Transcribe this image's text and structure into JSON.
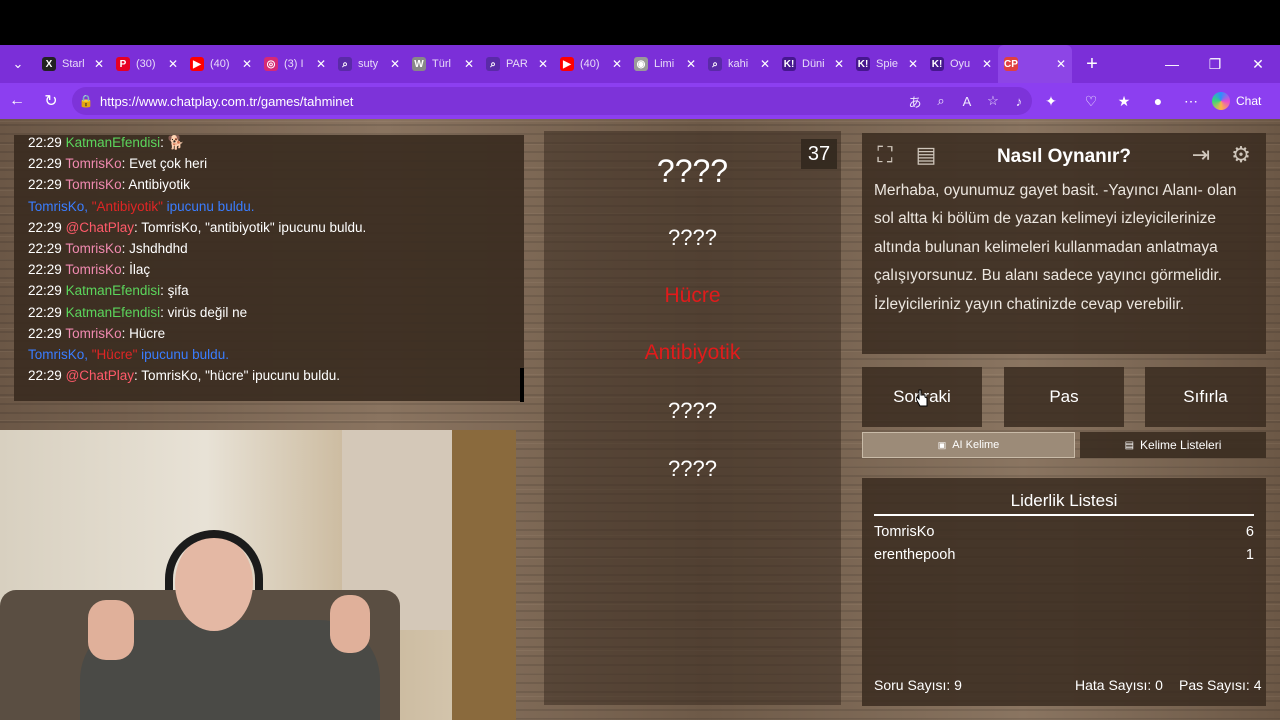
{
  "browser": {
    "tabs": [
      {
        "title": "Starl",
        "icon": "x-icon",
        "color": "#222222",
        "glyph": "X"
      },
      {
        "title": "(30)",
        "icon": "pinterest-icon",
        "color": "#e60023",
        "glyph": "P"
      },
      {
        "title": "(40)",
        "icon": "youtube-icon",
        "color": "#ff0000",
        "glyph": "▶"
      },
      {
        "title": "(3) I",
        "icon": "instagram-icon",
        "color": "#d62976",
        "glyph": "◎"
      },
      {
        "title": "suty",
        "icon": "search-icon",
        "color": "#5a2aa8",
        "glyph": "⌕"
      },
      {
        "title": "Türl",
        "icon": "wikipedia-icon",
        "color": "#888888",
        "glyph": "W"
      },
      {
        "title": "PAR",
        "icon": "search-icon",
        "color": "#5a2aa8",
        "glyph": "⌕"
      },
      {
        "title": "(40)",
        "icon": "youtube-icon",
        "color": "#ff0000",
        "glyph": "▶"
      },
      {
        "title": "Limi",
        "icon": "globe-icon",
        "color": "#9a9a9a",
        "glyph": "◉"
      },
      {
        "title": "kahi",
        "icon": "search-icon",
        "color": "#5a2aa8",
        "glyph": "⌕"
      },
      {
        "title": "Düni",
        "icon": "kahoot-icon",
        "color": "#46178f",
        "glyph": "K!"
      },
      {
        "title": "Spie",
        "icon": "kahoot-icon",
        "color": "#46178f",
        "glyph": "K!"
      },
      {
        "title": "Oyu",
        "icon": "kahoot-icon",
        "color": "#46178f",
        "glyph": "K!"
      },
      {
        "title": "",
        "icon": "chatplay-icon",
        "color": "#e04040",
        "glyph": "CP",
        "active": true
      }
    ],
    "url": "https://www.chatplay.com.tr/games/tahminet",
    "chat_label": "Chat"
  },
  "chat": {
    "messages": [
      {
        "time": "22:29",
        "user": "KatmanEfendisi",
        "user_color": "green",
        "text": ": 🐕"
      },
      {
        "time": "22:29",
        "user": "TomrisKo",
        "user_color": "pink",
        "text": ": Evet çok heri"
      },
      {
        "time": "22:29",
        "user": "TomrisKo",
        "user_color": "pink",
        "text": ": Antibiyotik"
      },
      {
        "system": true,
        "pre": "TomrisKo, ",
        "word": "\"Antibiyotik\"",
        "post": " ipucunu buldu."
      },
      {
        "time": "22:29",
        "user": "@ChatPlay",
        "user_color": "red",
        "text": ": TomrisKo, \"antibiyotik\" ipucunu buldu."
      },
      {
        "time": "22:29",
        "user": "TomrisKo",
        "user_color": "pink",
        "text": ": Jshdhdhd"
      },
      {
        "time": "22:29",
        "user": "TomrisKo",
        "user_color": "pink",
        "text": ": İlaç"
      },
      {
        "time": "22:29",
        "user": "KatmanEfendisi",
        "user_color": "green",
        "text": ": şifa"
      },
      {
        "time": "22:29",
        "user": "KatmanEfendisi",
        "user_color": "green",
        "text": ": virüs değil ne"
      },
      {
        "time": "22:29",
        "user": "TomrisKo",
        "user_color": "pink",
        "text": ": Hücre"
      },
      {
        "system": true,
        "pre": "TomrisKo, ",
        "word": "\"Hücre\"",
        "post": " ipucunu buldu."
      },
      {
        "time": "22:29",
        "user": "@ChatPlay",
        "user_color": "red",
        "text": ": TomrisKo, \"hücre\" ipucunu buldu."
      }
    ]
  },
  "game": {
    "timer": "37",
    "main_word": "????",
    "words": [
      {
        "text": "????",
        "found": false
      },
      {
        "text": "Hücre",
        "found": true
      },
      {
        "text": "Antibiyotik",
        "found": true
      },
      {
        "text": "????",
        "found": false
      },
      {
        "text": "????",
        "found": false
      }
    ]
  },
  "info": {
    "title": "Nasıl Oynanır?",
    "text": "Merhaba, oyunumuz gayet basit. -Yayıncı Alanı- olan sol altta ki bölüm de yazan kelimeyi izleyicilerinize altında bulunan kelimeleri kullanmadan anlatmaya çalışıyorsunuz. Bu alanı sadece yayıncı görmelidir. İzleyicileriniz yayın chatinizde cevap verebilir."
  },
  "controls": {
    "next_label": "Sonraki",
    "pass_label": "Pas",
    "reset_label": "Sıfırla",
    "ai_word_label": "AI Kelime",
    "word_lists_label": "Kelime Listeleri"
  },
  "leaderboard": {
    "title": "Liderlik Listesi",
    "rows": [
      {
        "name": "TomrisKo",
        "score": "6"
      },
      {
        "name": "erenthepooh",
        "score": "1"
      }
    ],
    "question_count": "Soru Sayısı: 9",
    "error_count": "Hata Sayısı: 0",
    "pass_count": "Pas Sayısı: 4"
  }
}
